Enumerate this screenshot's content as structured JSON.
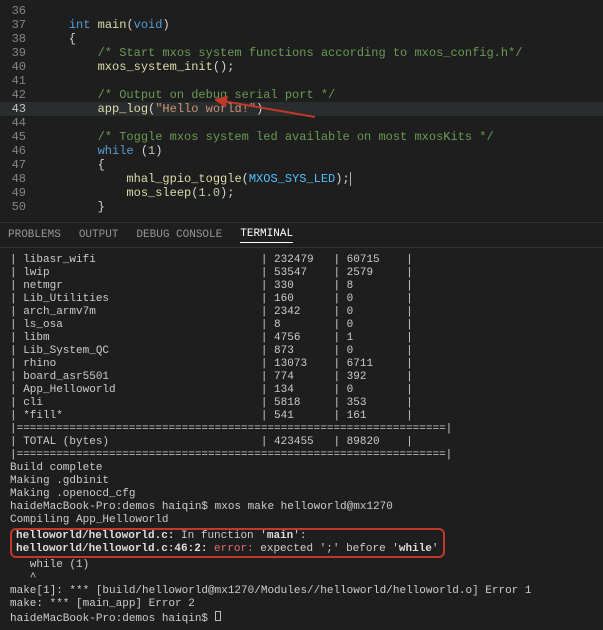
{
  "editor": {
    "lines": [
      {
        "n": 36,
        "seg": []
      },
      {
        "n": 37,
        "seg": [
          {
            "t": "    "
          },
          {
            "t": "int",
            "c": "kw"
          },
          {
            "t": " "
          },
          {
            "t": "main",
            "c": "fn"
          },
          {
            "t": "("
          },
          {
            "t": "void",
            "c": "kw"
          },
          {
            "t": ")"
          }
        ]
      },
      {
        "n": 38,
        "seg": [
          {
            "t": "    {"
          }
        ]
      },
      {
        "n": 39,
        "seg": [
          {
            "t": "        "
          },
          {
            "t": "/* Start mxos system functions according to mxos_config.h*/",
            "c": "cmt"
          }
        ]
      },
      {
        "n": 40,
        "seg": [
          {
            "t": "        "
          },
          {
            "t": "mxos_system_init",
            "c": "fn"
          },
          {
            "t": "();"
          }
        ]
      },
      {
        "n": 41,
        "seg": []
      },
      {
        "n": 42,
        "seg": [
          {
            "t": "        "
          },
          {
            "t": "/* Output on debug serial port */",
            "c": "cmt"
          }
        ]
      },
      {
        "n": 43,
        "active": true,
        "seg": [
          {
            "t": "        "
          },
          {
            "t": "app_log",
            "c": "fn"
          },
          {
            "t": "("
          },
          {
            "t": "\"Hello world!\"",
            "c": "str"
          },
          {
            "t": ")"
          }
        ]
      },
      {
        "n": 44,
        "seg": []
      },
      {
        "n": 45,
        "seg": [
          {
            "t": "        "
          },
          {
            "t": "/* Toggle mxos system led available on most mxosKits */",
            "c": "cmt"
          }
        ]
      },
      {
        "n": 46,
        "seg": [
          {
            "t": "        "
          },
          {
            "t": "while",
            "c": "kw"
          },
          {
            "t": " ("
          },
          {
            "t": "1",
            "c": "num"
          },
          {
            "t": ")"
          }
        ]
      },
      {
        "n": 47,
        "seg": [
          {
            "t": "        {"
          }
        ]
      },
      {
        "n": 48,
        "seg": [
          {
            "t": "            "
          },
          {
            "t": "mhal_gpio_toggle",
            "c": "fn"
          },
          {
            "t": "("
          },
          {
            "t": "MXOS_SYS_LED",
            "c": "const"
          },
          {
            "t": ");"
          }
        ],
        "cursor": true
      },
      {
        "n": 49,
        "seg": [
          {
            "t": "            "
          },
          {
            "t": "mos_sleep",
            "c": "fn"
          },
          {
            "t": "("
          },
          {
            "t": "1.0",
            "c": "num"
          },
          {
            "t": ");"
          }
        ]
      },
      {
        "n": 50,
        "seg": [
          {
            "t": "        }"
          }
        ]
      }
    ]
  },
  "tabs": {
    "items": [
      "PROBLEMS",
      "OUTPUT",
      "DEBUG CONSOLE",
      "TERMINAL"
    ],
    "active": 3
  },
  "terminal": {
    "table": [
      {
        "name": "libasr_wifi",
        "c1": "232479",
        "c2": "60715"
      },
      {
        "name": "lwip",
        "c1": "53547",
        "c2": "2579"
      },
      {
        "name": "netmgr",
        "c1": "330",
        "c2": "8"
      },
      {
        "name": "Lib_Utilities",
        "c1": "160",
        "c2": "0"
      },
      {
        "name": "arch_armv7m",
        "c1": "2342",
        "c2": "0"
      },
      {
        "name": "ls_osa",
        "c1": "8",
        "c2": "0"
      },
      {
        "name": "libm",
        "c1": "4756",
        "c2": "1"
      },
      {
        "name": "Lib_System_QC",
        "c1": "873",
        "c2": "0"
      },
      {
        "name": "rhino",
        "c1": "13073",
        "c2": "6711"
      },
      {
        "name": "board_asr5501",
        "c1": "774",
        "c2": "392"
      },
      {
        "name": "App_Helloworld",
        "c1": "134",
        "c2": "0"
      },
      {
        "name": "cli",
        "c1": "5818",
        "c2": "353"
      },
      {
        "name": "*fill*",
        "c1": "541",
        "c2": "161"
      }
    ],
    "totalLabel": "TOTAL (bytes)",
    "total": {
      "c1": "423455",
      "c2": "89820"
    },
    "sep": "|=================================================================|",
    "messages": [
      "Build complete",
      "Making .gdbinit",
      "Making .openocd_cfg",
      "haideMacBook-Pro:demos haiqin$ mxos make helloworld@mx1270",
      "Compiling App_Helloworld"
    ],
    "err1": {
      "pre": "helloworld/helloworld.c:",
      "mid": " In function '",
      "fn": "main",
      "post": "':"
    },
    "err2": {
      "loc": "helloworld/helloworld.c:46:2:",
      "kw": "error:",
      "msg": " expected ';' before '",
      "tok": "while",
      "post": "'"
    },
    "post": [
      "   while (1)",
      "   ^",
      "make[1]: *** [build/helloworld@mx1270/Modules//helloworld/helloworld.o] Error 1",
      "make: *** [main_app] Error 2"
    ],
    "prompt": "haideMacBook-Pro:demos haiqin$ "
  },
  "annotation": {
    "arrow_color": "#c0392b"
  }
}
